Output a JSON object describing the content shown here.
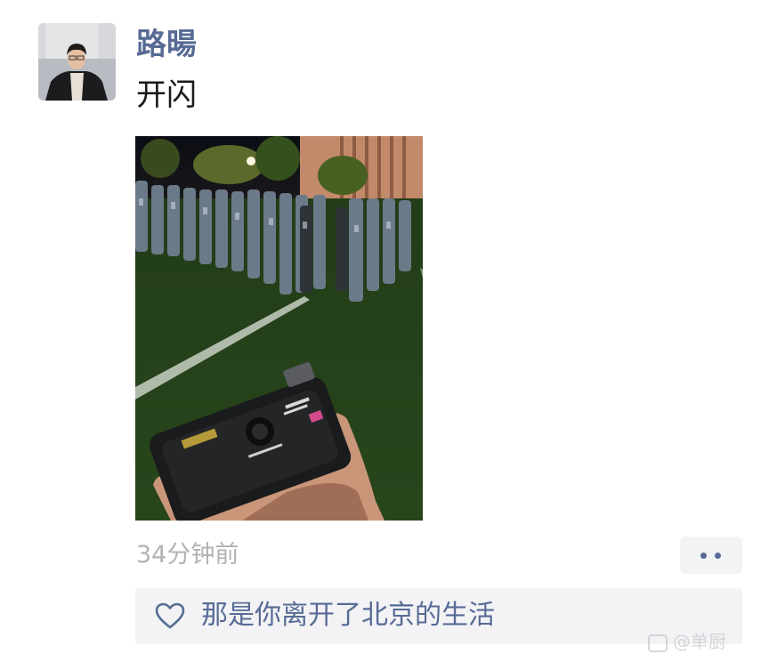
{
  "post": {
    "author": "路暘",
    "text": "开闪",
    "timestamp": "34分钟前"
  },
  "likes": {
    "text": "那是你离开了北京的生活"
  },
  "watermark": {
    "text": "@单厨"
  },
  "icons": {
    "avatar": "avatar",
    "photo": "photo",
    "more": "more-dots-icon",
    "heart": "heart-icon"
  },
  "colors": {
    "name": "#576b95",
    "timestamp": "#b2b2b2",
    "likes_background": "#f3f3f5"
  }
}
